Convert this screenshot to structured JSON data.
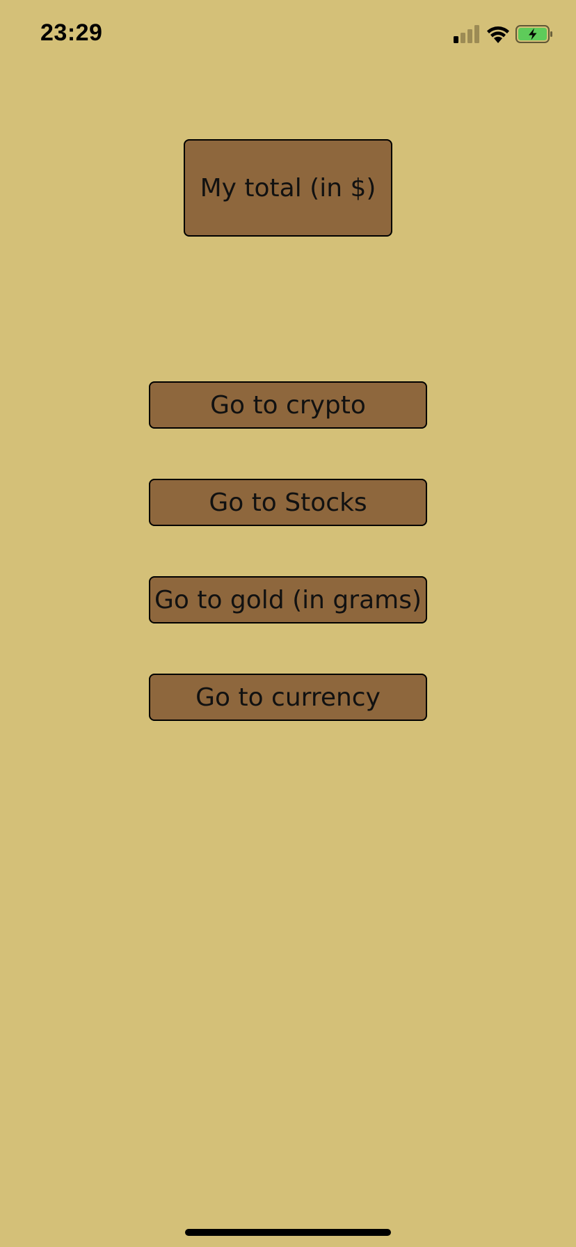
{
  "status_bar": {
    "time": "23:29",
    "signal_icon": "cellular-signal-icon",
    "wifi_icon": "wifi-icon",
    "battery_icon": "battery-charging-icon",
    "battery_color": "#5ecb5a"
  },
  "main": {
    "total_button_label": "My total (in $)",
    "nav_buttons": [
      {
        "label": "Go to crypto"
      },
      {
        "label": "Go to Stocks"
      },
      {
        "label": "Go to gold (in grams)"
      },
      {
        "label": "Go to currency"
      }
    ]
  },
  "colors": {
    "background": "#d4c078",
    "button_fill": "#8e673d",
    "button_border": "#000000"
  }
}
